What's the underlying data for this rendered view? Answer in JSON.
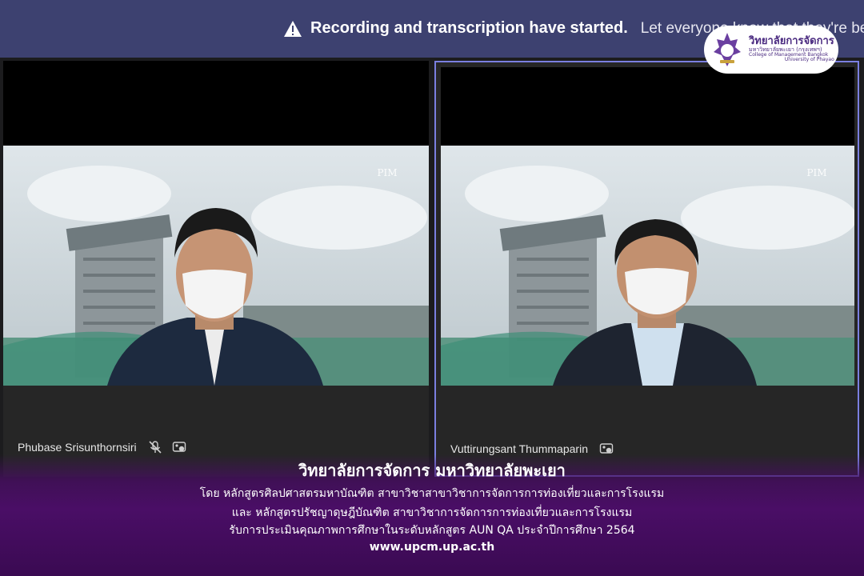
{
  "banner": {
    "title": "Recording and transcription have started.",
    "description": "Let everyone know that they're being"
  },
  "logo": {
    "line1": "วิทยาลัยการจัดการ",
    "line2": "มหาวิทยาลัยพะเยา (กรุงเทพฯ)",
    "line3": "College of Management Bangkok",
    "line4": "University of Phayao"
  },
  "participants": [
    {
      "name": "Phubase Srisunthornsiri",
      "muted": true
    },
    {
      "name": "Vuttirungsant Thummaparin",
      "muted": false
    }
  ],
  "background_watermark": "PIM",
  "caption": {
    "title": "วิทยาลัยการจัดการ มหาวิทยาลัยพะเยา",
    "line1": "โดย หลักสูตรศิลปศาสตรมหาบัณฑิต สาขาวิชาสาขาวิชาการจัดการการท่องเที่ยวและการโรงแรม",
    "line2": "และ หลักสูตรปรัชญาดุษฎีบัณฑิต สาขาวิชาการจัดการการท่องเที่ยวและการโรงแรม",
    "line3": "รับการประเมินคุณภาพการศึกษาในระดับหลักสูตร AUN QA ประจำปีการศึกษา 2564",
    "url": "www.upcm.up.ac.th"
  }
}
